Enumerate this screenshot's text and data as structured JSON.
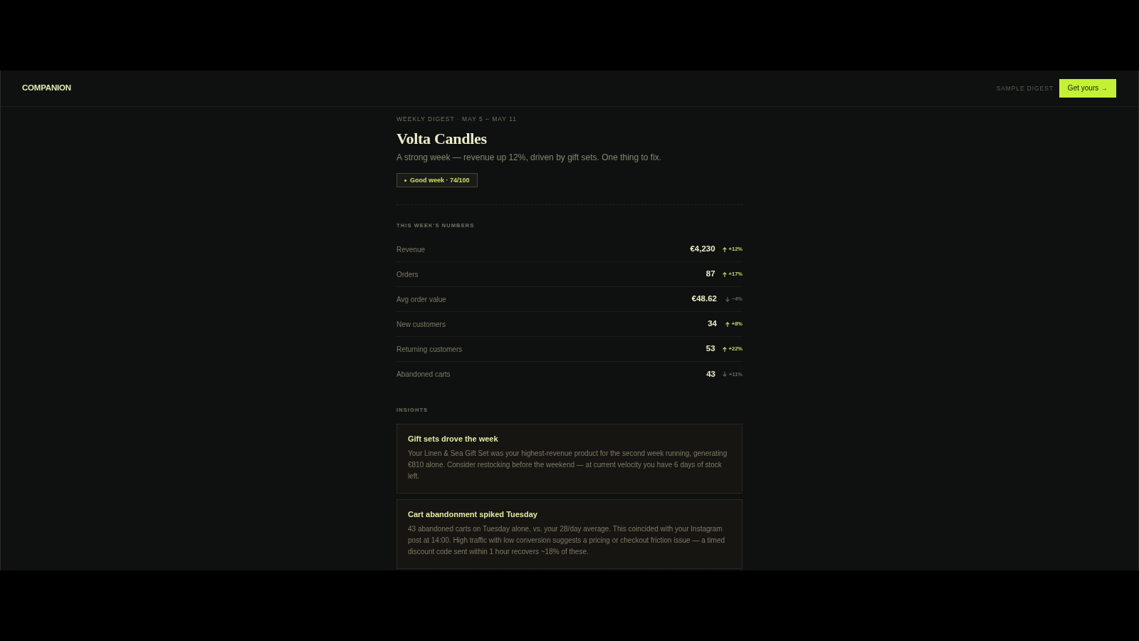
{
  "header": {
    "logo": "COMPANION",
    "nav_link": "SAMPLE DIGEST",
    "cta_button": "Get yours →"
  },
  "digest": {
    "eyebrow": "WEEKLY DIGEST · MAY 5 – MAY 11",
    "title": "Volta Candles",
    "summary": "A strong week — revenue up 12%, driven by gift sets. One thing to fix.",
    "badge": "Good week · 74/100"
  },
  "numbers": {
    "heading": "THIS WEEK'S NUMBERS",
    "metrics": [
      {
        "label": "Revenue",
        "value": "€4,230",
        "change": "+12%",
        "kind": "up"
      },
      {
        "label": "Orders",
        "value": "87",
        "change": "+17%",
        "kind": "up"
      },
      {
        "label": "Avg order value",
        "value": "€48.62",
        "change": "−4%",
        "kind": "down"
      },
      {
        "label": "New customers",
        "value": "34",
        "change": "+8%",
        "kind": "up"
      },
      {
        "label": "Returning customers",
        "value": "53",
        "change": "+22%",
        "kind": "up"
      },
      {
        "label": "Abandoned carts",
        "value": "43",
        "change": "+11%",
        "kind": "down"
      }
    ]
  },
  "insights": {
    "heading": "INSIGHTS",
    "cards": [
      {
        "title": "Gift sets drove the week",
        "body": "Your Linen & Sea Gift Set was your highest-revenue product for the second week running, generating €810 alone. Consider restocking before the weekend — at current velocity you have 6 days of stock left."
      },
      {
        "title": "Cart abandonment spiked Tuesday",
        "body": "43 abandoned carts on Tuesday alone, vs. your 28/day average. This coincided with your Instagram post at 14:00. High traffic with low conversion suggests a pricing or checkout friction issue — a timed discount code sent within 1 hour recovers ~18% of these."
      }
    ]
  }
}
